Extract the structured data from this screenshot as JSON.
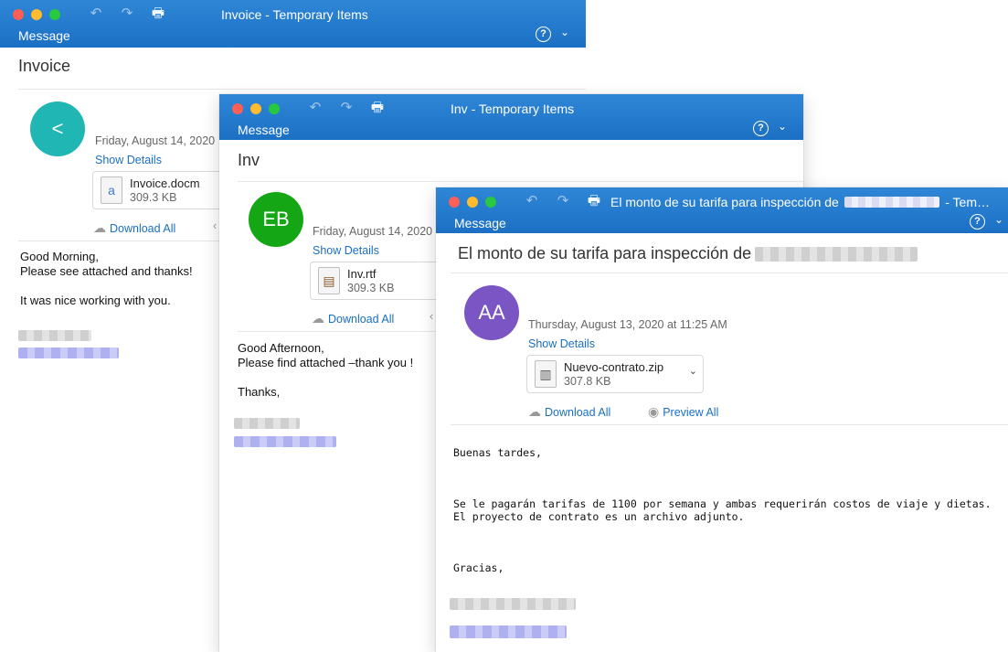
{
  "windows": [
    {
      "title": "Invoice - Temporary Items",
      "ribbon_tab": "Message",
      "subject": "Invoice",
      "avatar": {
        "initials": "<",
        "color": "#1fb6b3"
      },
      "date": "Friday, August 14, 2020",
      "show_details": "Show Details",
      "attachment": {
        "name": "Invoice.docm",
        "size": "309.3 KB"
      },
      "download_all": "Download All",
      "body": [
        "Good Morning,",
        "Please see attached and thanks!",
        "",
        "It was nice working with you."
      ]
    },
    {
      "title": "Inv - Temporary Items",
      "ribbon_tab": "Message",
      "subject": "Inv",
      "avatar": {
        "initials": "EB",
        "color": "#14a614"
      },
      "date": "Friday, August 14, 2020",
      "show_details": "Show Details",
      "attachment": {
        "name": "Inv.rtf",
        "size": "309.3 KB"
      },
      "download_all": "Download All",
      "body": [
        "Good Afternoon,",
        "Please find attached –thank you !",
        "",
        "Thanks,"
      ]
    },
    {
      "title_prefix": "El monto de su tarifa para inspección de",
      "title_suffix": "- Tem…",
      "ribbon_tab": "Message",
      "subject": "El monto de su tarifa para inspección de",
      "avatar": {
        "initials": "AA",
        "color": "#7b55c4"
      },
      "date": "Thursday, August 13, 2020 at 11:25 AM",
      "show_details": "Show Details",
      "attachment": {
        "name": "Nuevo-contrato.zip",
        "size": "307.8 KB"
      },
      "download_all": "Download All",
      "preview_all": "Preview All",
      "body": [
        "Buenas tardes,",
        "",
        "",
        "Se le pagarán tarifas de 1100 por semana y ambas requerirán costos de viaje y dietas.",
        "El proyecto de contrato es un archivo adjunto.",
        "",
        "",
        "Gracias,"
      ]
    }
  ],
  "colors": {
    "titlebar": "#1b70c4",
    "link": "#1a6fc4"
  },
  "icons": [
    "undo-icon",
    "redo-icon",
    "print-icon",
    "help-icon",
    "chevron-down-icon",
    "cloud-download-icon",
    "eye-icon",
    "chevron-left-icon"
  ]
}
